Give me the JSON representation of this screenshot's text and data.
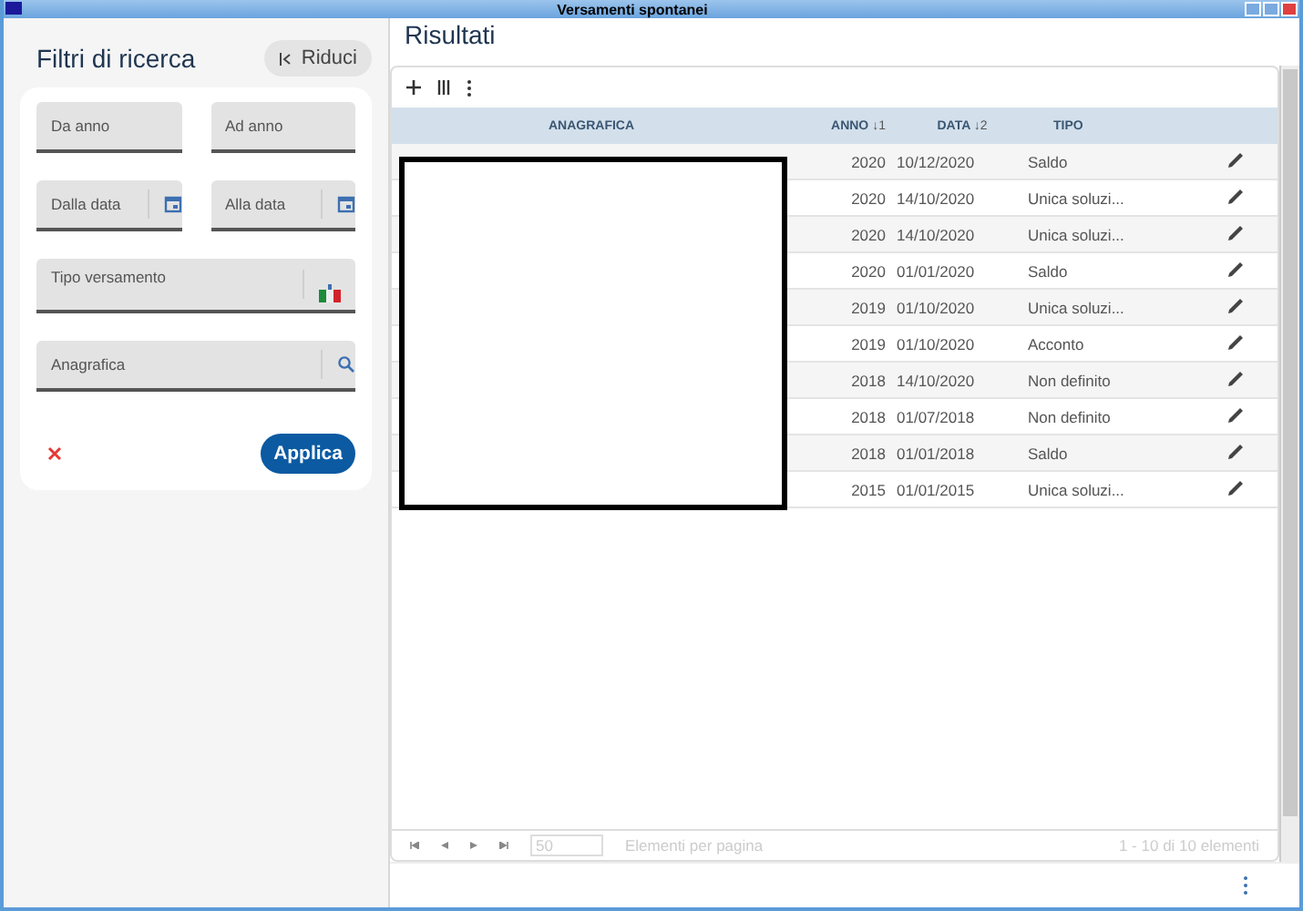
{
  "window": {
    "title": "Versamenti spontanei"
  },
  "filters": {
    "title": "Filtri di ricerca",
    "collapse_button": "Riduci",
    "fields": [
      {
        "kind": "text",
        "placeholder": "Da anno"
      },
      {
        "kind": "text",
        "placeholder": "Ad anno"
      },
      {
        "kind": "date",
        "placeholder": "Dalla data"
      },
      {
        "kind": "date",
        "placeholder": "Alla data"
      },
      {
        "kind": "select",
        "label": "Tipo versamento"
      },
      {
        "kind": "search",
        "placeholder": "Anagrafica"
      }
    ],
    "apply_button": "Applica"
  },
  "results": {
    "title": "Risultati",
    "columns": [
      {
        "label": "ANAGRAFICA"
      },
      {
        "label": "ANNO",
        "sort": "↓1"
      },
      {
        "label": "DATA",
        "sort": "↓2"
      },
      {
        "label": "TIPO"
      }
    ],
    "rows": [
      {
        "anno": "2020",
        "data": "10/12/2020",
        "tipo": "Saldo"
      },
      {
        "anno": "2020",
        "data": "14/10/2020",
        "tipo": "Unica soluzi..."
      },
      {
        "anno": "2020",
        "data": "14/10/2020",
        "tipo": "Unica soluzi..."
      },
      {
        "anno": "2020",
        "data": "01/01/2020",
        "tipo": "Saldo"
      },
      {
        "anno": "2019",
        "data": "01/10/2020",
        "tipo": "Unica soluzi..."
      },
      {
        "anno": "2019",
        "data": "01/10/2020",
        "tipo": "Acconto"
      },
      {
        "anno": "2018",
        "data": "14/10/2020",
        "tipo": "Non definito"
      },
      {
        "anno": "2018",
        "data": "01/07/2018",
        "tipo": "Non definito"
      },
      {
        "anno": "2018",
        "data": "01/01/2018",
        "tipo": "Saldo"
      },
      {
        "anno": "2015",
        "data": "01/01/2015",
        "tipo": "Unica soluzi..."
      }
    ],
    "page_size": "50",
    "page_size_label": "Elementi per pagina",
    "range": "1 - 10 di 10 elementi"
  }
}
